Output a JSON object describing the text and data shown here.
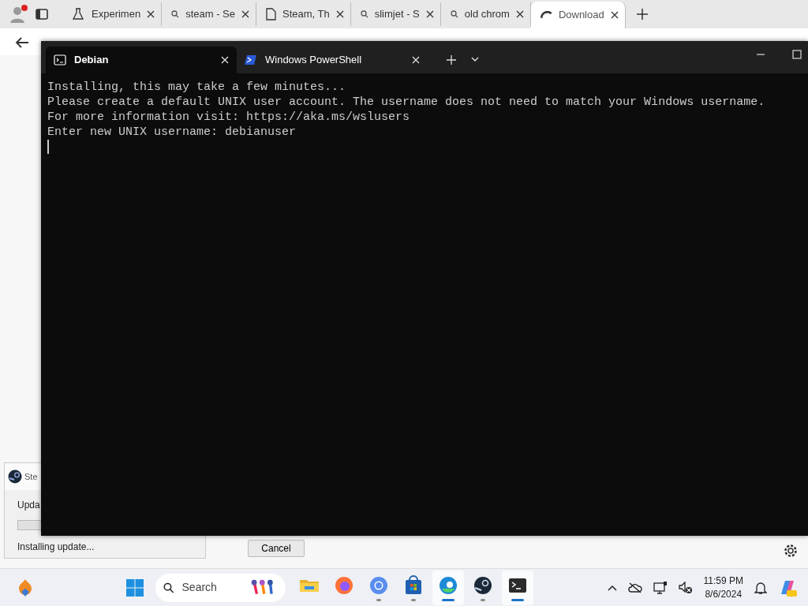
{
  "browser": {
    "tabs": [
      {
        "label": "Experimen",
        "kind": "flask",
        "selected": false
      },
      {
        "label": "steam - Se",
        "kind": "search",
        "selected": false
      },
      {
        "label": "Steam, Th",
        "kind": "page",
        "selected": false
      },
      {
        "label": "slimjet - S",
        "kind": "search",
        "selected": false
      },
      {
        "label": "old chrom",
        "kind": "search",
        "selected": false
      },
      {
        "label": "Download",
        "kind": "spinner",
        "selected": true
      }
    ]
  },
  "terminal": {
    "tabs": [
      {
        "label": "Debian",
        "kind": "console",
        "selected": true
      },
      {
        "label": "Windows PowerShell",
        "kind": "powershell",
        "selected": false
      }
    ],
    "lines": [
      "Installing, this may take a few minutes...",
      "Please create a default UNIX user account. The username does not need to match your Windows username.",
      "For more information visit: https://aka.ms/wslusers",
      "Enter new UNIX username: debianuser"
    ],
    "cursor": true
  },
  "steam_dialog": {
    "title": "Ste",
    "heading": "Upda",
    "level": 0,
    "status": "Installing update...",
    "cancel": "Cancel"
  },
  "taskbar": {
    "search_placeholder": "Search",
    "apps": [
      {
        "kind": "folder",
        "running": false,
        "selected": false
      },
      {
        "kind": "firefox",
        "running": false,
        "selected": false
      },
      {
        "kind": "chrome",
        "running": true,
        "selected": false
      },
      {
        "kind": "store",
        "running": true,
        "selected": false
      },
      {
        "kind": "edge",
        "running": true,
        "selected": true
      },
      {
        "kind": "steam",
        "running": true,
        "selected": false
      },
      {
        "kind": "terminal",
        "running": true,
        "selected": true
      }
    ],
    "time": "11:59 PM",
    "date": "8/6/2024"
  }
}
